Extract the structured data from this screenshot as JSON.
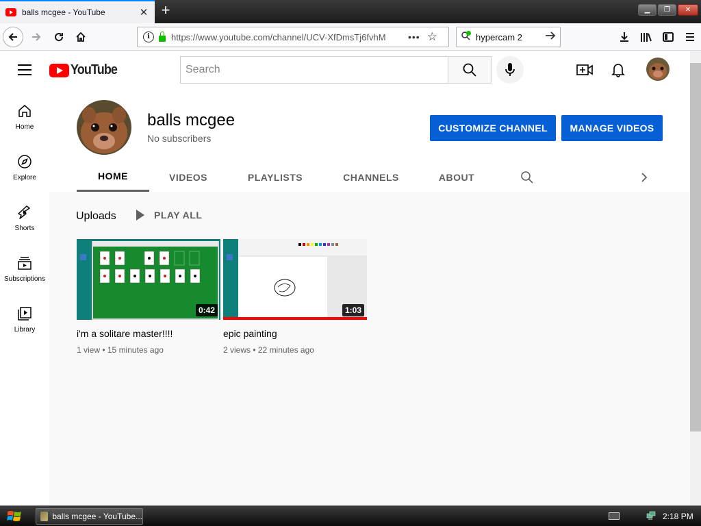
{
  "browser": {
    "tab_title": "balls mcgee - YouTube",
    "tab_close": "✕",
    "new_tab": "+",
    "url": "https://www.youtube.com/channel/UCV-XfDmsTj6fvhM",
    "url_more": "•••",
    "search_value": "hypercam 2",
    "window_buttons": [
      "▁",
      "❐",
      "✕"
    ]
  },
  "youtube": {
    "logo_text": "YouTube",
    "search_placeholder": "Search"
  },
  "sidebar": {
    "items": [
      {
        "label": "Home",
        "icon": "home-icon"
      },
      {
        "label": "Explore",
        "icon": "compass-icon"
      },
      {
        "label": "Shorts",
        "icon": "shorts-icon"
      },
      {
        "label": "Subscriptions",
        "icon": "subscriptions-icon"
      },
      {
        "label": "Library",
        "icon": "library-icon"
      }
    ]
  },
  "channel": {
    "name": "balls mcgee",
    "subscribers": "No subscribers",
    "customize_label": "CUSTOMIZE CHANNEL",
    "manage_label": "MANAGE VIDEOS",
    "tabs": [
      "HOME",
      "VIDEOS",
      "PLAYLISTS",
      "CHANNELS",
      "ABOUT"
    ],
    "active_tab": "HOME"
  },
  "uploads": {
    "title": "Uploads",
    "play_all": "PLAY ALL",
    "videos": [
      {
        "title": "i'm a solitare master!!!!",
        "duration": "0:42",
        "meta": "1 view • 15 minutes ago",
        "watched_fraction": 0
      },
      {
        "title": "epic painting",
        "duration": "1:03",
        "meta": "2 views • 22 minutes ago",
        "watched_fraction": 1.0
      }
    ]
  },
  "taskbar": {
    "task_label": "balls mcgee - YouTube...",
    "clock": "2:18 PM"
  },
  "colors": {
    "accent_blue": "#065fd4",
    "youtube_red": "#ff0000",
    "firefox_blue": "#0a84ff"
  }
}
